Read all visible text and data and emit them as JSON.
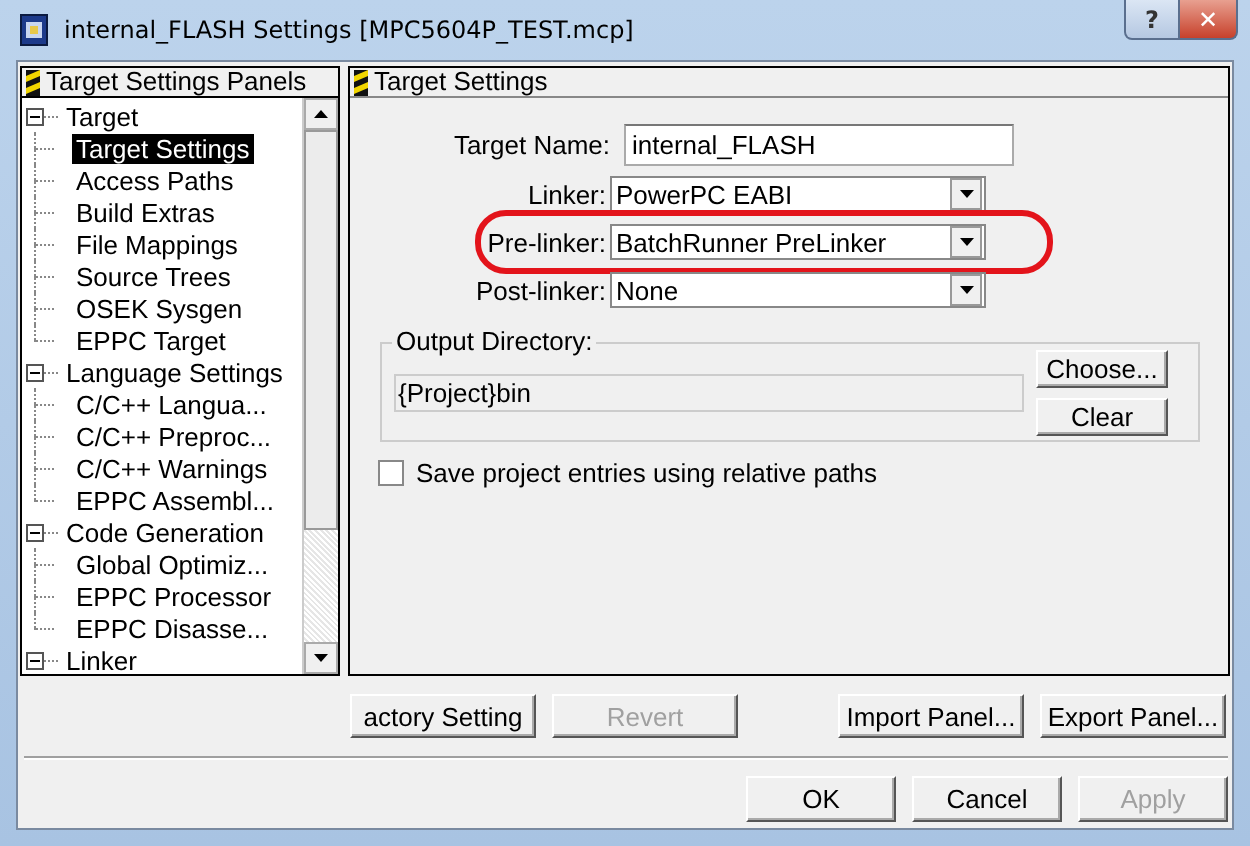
{
  "window": {
    "title": "internal_FLASH Settings [MPC5604P_TEST.mcp]",
    "help_button": "?",
    "close_button": "✕"
  },
  "panels_list": {
    "title": "Target Settings Panels",
    "items": [
      {
        "label": "Target",
        "expanded": true,
        "selected": false,
        "children": [
          {
            "label": "Target Settings",
            "selected": true
          },
          {
            "label": "Access Paths",
            "selected": false
          },
          {
            "label": "Build Extras",
            "selected": false
          },
          {
            "label": "File Mappings",
            "selected": false
          },
          {
            "label": "Source Trees",
            "selected": false
          },
          {
            "label": "OSEK Sysgen",
            "selected": false
          },
          {
            "label": "EPPC Target",
            "selected": false
          }
        ]
      },
      {
        "label": "Language Settings",
        "expanded": true,
        "selected": false,
        "children": [
          {
            "label": "C/C++ Langua...",
            "selected": false
          },
          {
            "label": "C/C++ Preproc...",
            "selected": false
          },
          {
            "label": "C/C++ Warnings",
            "selected": false
          },
          {
            "label": "EPPC Assembl...",
            "selected": false
          }
        ]
      },
      {
        "label": "Code Generation",
        "expanded": true,
        "selected": false,
        "children": [
          {
            "label": "Global Optimiz...",
            "selected": false
          },
          {
            "label": "EPPC Processor",
            "selected": false
          },
          {
            "label": "EPPC Disasse...",
            "selected": false
          }
        ]
      },
      {
        "label": "Linker",
        "expanded": true,
        "selected": false
      }
    ]
  },
  "settings": {
    "title": "Target Settings",
    "target_name": {
      "label": "Target Name:",
      "value": "internal_FLASH"
    },
    "dropdowns": [
      {
        "label": "Linker:",
        "value": "PowerPC EABI",
        "highlighted": false
      },
      {
        "label": "Pre-linker:",
        "value": "BatchRunner PreLinker",
        "highlighted": true
      },
      {
        "label": "Post-linker:",
        "value": "None",
        "highlighted": false
      }
    ],
    "output_directory": {
      "label": "Output Directory:",
      "value": "{Project}bin",
      "buttons": [
        "Choose...",
        "Clear"
      ]
    },
    "relative_paths": {
      "label": "Save project entries using relative paths",
      "checked": false
    }
  },
  "panel_buttons": [
    {
      "label": "actory Setting",
      "disabled": false
    },
    {
      "label": "Revert",
      "disabled": true
    },
    {
      "label": "Import Panel...",
      "disabled": false
    },
    {
      "label": "Export Panel...",
      "disabled": false
    }
  ],
  "dialog_buttons": [
    {
      "label": "OK",
      "disabled": false
    },
    {
      "label": "Cancel",
      "disabled": false
    },
    {
      "label": "Apply",
      "disabled": true
    }
  ]
}
